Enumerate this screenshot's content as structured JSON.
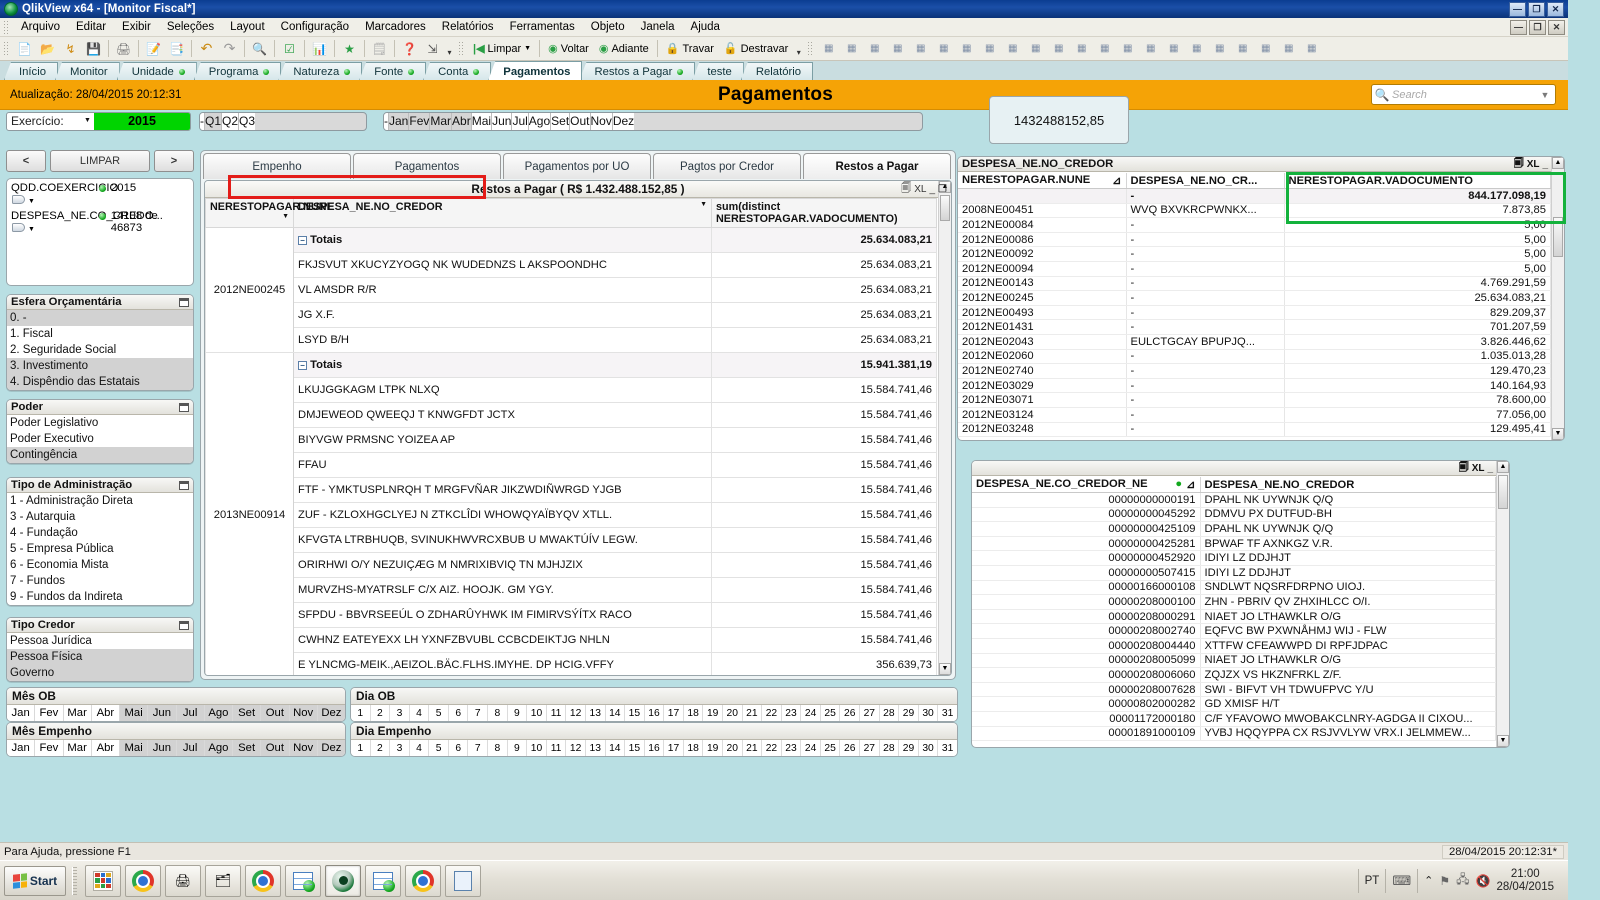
{
  "window": {
    "title": "QlikView x64 - [Monitor Fiscal*]",
    "app_icon": "qlikview-logo-icon",
    "controls": {
      "minimize": "—",
      "maximize": "❐",
      "close": "✕",
      "doc_minimize": "—",
      "doc_restore": "❐",
      "doc_close": "✕"
    }
  },
  "menu": [
    "Arquivo",
    "Editar",
    "Exibir",
    "Seleções",
    "Layout",
    "Configuração",
    "Marcadores",
    "Relatórios",
    "Ferramentas",
    "Objeto",
    "Janela",
    "Ajuda"
  ],
  "toolbar": {
    "group1_icons": [
      "new-document-icon",
      "open-folder-icon",
      "reload-icon",
      "save-icon"
    ],
    "print_icon": "print-icon",
    "group2_icons": [
      "edit-script-icon",
      "table-viewer-icon"
    ],
    "undo_icon": "undo-icon",
    "redo_icon": "redo-icon",
    "search_icon": "search-icon",
    "select-icon": "checkmark-icon",
    "chart_icon": "chart-icon",
    "favorite_icon": "star-icon",
    "notes_icon": "notes-icon",
    "help_icon": "help-icon",
    "context-help_icon": "context-help-icon",
    "clear_label": "Limpar",
    "back_label": "Voltar",
    "forward_label": "Adiante",
    "lock_label": "Travar",
    "unlock_label": "Destravar"
  },
  "sheet_tabs": [
    {
      "label": "Início",
      "active": false,
      "dot": false
    },
    {
      "label": "Monitor",
      "active": false,
      "dot": false
    },
    {
      "label": "Unidade",
      "active": false,
      "dot": true
    },
    {
      "label": "Programa",
      "active": false,
      "dot": true
    },
    {
      "label": "Natureza",
      "active": false,
      "dot": true
    },
    {
      "label": "Fonte",
      "active": false,
      "dot": true
    },
    {
      "label": "Conta",
      "active": false,
      "dot": true
    },
    {
      "label": "Pagamentos",
      "active": true,
      "dot": false
    },
    {
      "label": "Restos a Pagar",
      "active": false,
      "dot": true
    },
    {
      "label": "teste",
      "active": false,
      "dot": false
    },
    {
      "label": "Relatório",
      "active": false,
      "dot": false
    }
  ],
  "header": {
    "update_label": "Atualização: 28/04/2015 20:12:31",
    "title": "Pagamentos",
    "search_placeholder": "Search",
    "search_icon": "search-icon",
    "dropdown_icon": "chevron-down-icon"
  },
  "exercicio": {
    "label": "Exercício:",
    "value": "2015"
  },
  "quarters": [
    {
      "label": "-",
      "selected": false
    },
    {
      "label": "Q1",
      "selected": true
    },
    {
      "label": "Q2",
      "selected": false
    },
    {
      "label": "Q3",
      "selected": false
    }
  ],
  "months_top": [
    {
      "label": "-",
      "selected": false
    },
    {
      "label": "Jan",
      "selected": true
    },
    {
      "label": "Fev",
      "selected": true
    },
    {
      "label": "Mar",
      "selected": true
    },
    {
      "label": "Abr",
      "selected": true
    },
    {
      "label": "Mai",
      "selected": false
    },
    {
      "label": "Jun",
      "selected": false
    },
    {
      "label": "Jul",
      "selected": false
    },
    {
      "label": "Ago",
      "selected": false
    },
    {
      "label": "Set",
      "selected": false
    },
    {
      "label": "Out",
      "selected": false
    },
    {
      "label": "Nov",
      "selected": false
    },
    {
      "label": "Dez",
      "selected": false
    }
  ],
  "nav_buttons": {
    "prev": "<",
    "clear": "LIMPAR",
    "next": ">"
  },
  "current_selections": [
    {
      "field": "QDD.COEXERCICIO",
      "value": "2015"
    },
    {
      "field": "DESPESA_NE.CO_CREDO...",
      "value": "14108 de 46873"
    }
  ],
  "listboxes": [
    {
      "title": "Esfera Orçamentária",
      "items": [
        {
          "label": "0. -",
          "state": "gray"
        },
        {
          "label": "1. Fiscal",
          "state": "white"
        },
        {
          "label": "2. Seguridade Social",
          "state": "white"
        },
        {
          "label": "3. Investimento",
          "state": "gray"
        },
        {
          "label": "4. Dispêndio das Estatais",
          "state": "gray"
        }
      ]
    },
    {
      "title": "Poder",
      "items": [
        {
          "label": "Poder Legislativo",
          "state": "white"
        },
        {
          "label": "Poder Executivo",
          "state": "white"
        },
        {
          "label": "Contingência",
          "state": "gray"
        }
      ]
    },
    {
      "title": "Tipo de Administração",
      "items": [
        {
          "label": "1 - Administração Direta",
          "state": "white"
        },
        {
          "label": "3 - Autarquia",
          "state": "white"
        },
        {
          "label": "4 - Fundação",
          "state": "white"
        },
        {
          "label": "5 - Empresa Pública",
          "state": "white"
        },
        {
          "label": "6 - Economia Mista",
          "state": "white"
        },
        {
          "label": "7 - Fundos",
          "state": "white"
        },
        {
          "label": "9 - Fundos da Indireta",
          "state": "white"
        }
      ]
    },
    {
      "title": "Tipo Credor",
      "items": [
        {
          "label": "Pessoa Jurídica",
          "state": "white"
        },
        {
          "label": "Pessoa Física",
          "state": "gray"
        },
        {
          "label": "Governo",
          "state": "gray"
        }
      ]
    }
  ],
  "center": {
    "tabs": [
      {
        "label": "Empenho",
        "active": false
      },
      {
        "label": "Pagamentos",
        "active": false
      },
      {
        "label": "Pagamentos por UO",
        "active": false
      },
      {
        "label": "Pagtos por Credor",
        "active": false
      },
      {
        "label": "Restos a Pagar",
        "active": true
      }
    ],
    "chart_title": "Restos a Pagar ( R$ 1.432.488.152,85 )",
    "export_icon": "export-excel-icon",
    "export_label": "XL",
    "minimize_icon": "minimize-icon",
    "maximize_icon": "maximize-icon",
    "columns": [
      "NERESTOPAGAR.NUNE",
      "DESPESA_NE.NO_CREDOR",
      "sum(distinct NERESTOPAGAR.VADOCUMENTO)"
    ],
    "sort_icon": "sort-chevron-icon",
    "groups": [
      {
        "dim": "2012NE00245",
        "total_label": "Totais",
        "total_value": "25.634.083,21",
        "rows": [
          {
            "credor": "FKJSVUT  XKUCYZYOGQ NK  WUDEDNZS L  AKSPOONDHC",
            "value": "25.634.083,21"
          },
          {
            "credor": "VL AMSDR R/R",
            "value": "25.634.083,21"
          },
          {
            "credor": "JG X.F.",
            "value": "25.634.083,21"
          },
          {
            "credor": "LSYD B/H",
            "value": "25.634.083,21"
          }
        ]
      },
      {
        "dim": "2013NE00914",
        "total_label": "Totais",
        "total_value": "15.941.381,19",
        "rows": [
          {
            "credor": "LKUJGGKAGM LTPK NLXQ",
            "value": "15.584.741,46"
          },
          {
            "credor": "DMJEWEOD  QWEEQJ  T  KNWGFDT  JCTX",
            "value": "15.584.741,46"
          },
          {
            "credor": "BIYVGW PRMSNC YOIZEA AP",
            "value": "15.584.741,46"
          },
          {
            "credor": "FFAU",
            "value": "15.584.741,46"
          },
          {
            "credor": "FTF -  YMKTUSPLNRQH  T  MRGFVÑAR  JIKZWDIÑWRGD  YJGB",
            "value": "15.584.741,46"
          },
          {
            "credor": "ZUF -  KZLOXHGCLYEJ N  ZTKCLÎDI  WHOWQYAÏBYQV  XTLL.",
            "value": "15.584.741,46"
          },
          {
            "credor": "KFVGTA  LTRBHUQB,  SVINUKHWVRCXBUB  U  MWAKTÚÍV  LEGW.",
            "value": "15.584.741,46"
          },
          {
            "credor": "ORIRHWI  O/Y  NEZUIÇÆG  M  NMRIXIBVIQ  TN  MJHJZIX",
            "value": "15.584.741,46"
          },
          {
            "credor": "MURVZHS-MYATRSLF C/X AIZ. HOOJK. GM YGY.",
            "value": "15.584.741,46"
          },
          {
            "credor": "SFPDU -  BBVRSEEÚL  O  ZDHARÛYHWK  IM  FIMIRVSÝÍTX  RACO",
            "value": "15.584.741,46"
          },
          {
            "credor": "CWHNZ  EATEYEXX  LH  YXNFZBVUBL  CCBCDEIKTJG  NHLN",
            "value": "15.584.741,46"
          },
          {
            "credor": "E  YLNCMG-MEIK.,AEIZOL.BÄC.FLHS.IMYHE.  DP  HCIG.VFFY",
            "value": "356.639,73"
          }
        ]
      }
    ]
  },
  "kpi": {
    "value": "1432488152,85"
  },
  "right_top": {
    "caption": "DESPESA_NE.NO_CREDOR",
    "export_icon": "export-excel-icon",
    "export_label": "XL",
    "minimize_icon": "minimize-icon",
    "maximize_icon": "maximize-icon",
    "columns": [
      "NERESTOPAGAR.NUNE",
      "DESPESA_NE.NO_CR...",
      "NERESTOPAGAR.VADOCUMENTO"
    ],
    "sort_icon": "sort-asc-icon",
    "total_row": {
      "nune": "",
      "credor": "-",
      "value": "844.177.098,19"
    },
    "rows": [
      {
        "nune": "2008NE00451",
        "credor": "WVQ BXVKRCPWNKX...",
        "value": "7.873,85"
      },
      {
        "nune": "2012NE00084",
        "credor": "-",
        "value": "5,00"
      },
      {
        "nune": "2012NE00086",
        "credor": "-",
        "value": "5,00"
      },
      {
        "nune": "2012NE00092",
        "credor": "-",
        "value": "5,00"
      },
      {
        "nune": "2012NE00094",
        "credor": "-",
        "value": "5,00"
      },
      {
        "nune": "2012NE00143",
        "credor": "-",
        "value": "4.769.291,59"
      },
      {
        "nune": "2012NE00245",
        "credor": "-",
        "value": "25.634.083,21"
      },
      {
        "nune": "2012NE00493",
        "credor": "-",
        "value": "829.209,37"
      },
      {
        "nune": "2012NE01431",
        "credor": "-",
        "value": "701.207,59"
      },
      {
        "nune": "2012NE02043",
        "credor": "EULCTGCAY BPUPJQ...",
        "value": "3.826.446,62"
      },
      {
        "nune": "2012NE02060",
        "credor": "-",
        "value": "1.035.013,28"
      },
      {
        "nune": "2012NE02740",
        "credor": "-",
        "value": "129.470,23"
      },
      {
        "nune": "2012NE03029",
        "credor": "-",
        "value": "140.164,93"
      },
      {
        "nune": "2012NE03071",
        "credor": "-",
        "value": "78.600,00"
      },
      {
        "nune": "2012NE03124",
        "credor": "-",
        "value": "77.056,00"
      },
      {
        "nune": "2012NE03248",
        "credor": "-",
        "value": "129.495,41"
      }
    ]
  },
  "right_bottom": {
    "export_icon": "export-excel-icon",
    "export_label": "XL",
    "minimize_icon": "minimize-icon",
    "maximize_icon": "maximize-icon",
    "columns": [
      "DESPESA_NE.CO_CREDOR_NE",
      "DESPESA_NE.NO_CREDOR"
    ],
    "sort_icon": "sort-asc-icon",
    "green_dot": "green-state-dot-icon",
    "rows": [
      {
        "code": "00000000000191",
        "name": "DPAHL NK UYWNJK Q/Q"
      },
      {
        "code": "00000000045292",
        "name": "DDMVU PX DUTFUD-BH"
      },
      {
        "code": "00000000425109",
        "name": "DPAHL NK UYWNJK Q/Q"
      },
      {
        "code": "00000000425281",
        "name": "BPWAF TF AXNKGZ V.R."
      },
      {
        "code": "00000000452920",
        "name": "IDIYI LZ DDJHJT"
      },
      {
        "code": "00000000507415",
        "name": "IDIYI LZ DDJHJT"
      },
      {
        "code": "00000166000108",
        "name": "SNDLWT NQSRFDRPNO UIOJ."
      },
      {
        "code": "00000208000100",
        "name": "ZHN - PBRIV QV ZHXIHLCC O/I."
      },
      {
        "code": "00000208000291",
        "name": "NIAET JO LTHAWKLR O/G"
      },
      {
        "code": "00000208002740",
        "name": "EQFVC BW PXWNÅHMJ WIJ - FLW"
      },
      {
        "code": "00000208004440",
        "name": "XTTFW CFEAWWPD DI RPFJDPAC"
      },
      {
        "code": "00000208005099",
        "name": "NIAET JO LTHAWKLR O/G"
      },
      {
        "code": "00000208006060",
        "name": "ZQJZX VS HKZNFRKL  Z/F."
      },
      {
        "code": "00000208007628",
        "name": "SWI - BIFVT VH TDWUFPVC Y/U"
      },
      {
        "code": "00000802000282",
        "name": "GD XMISF H/T"
      },
      {
        "code": "00001172000180",
        "name": "C/F  YFAVOWO  MWOBAKCLNRY-AGDGA    II  CIXOU..."
      },
      {
        "code": "00001891000109",
        "name": "YVBJ  HQQYPPA  CX  RSJVVLYW  VRX.I  JELMMEW..."
      }
    ]
  },
  "bottom_panels": [
    {
      "title": "Mês OB",
      "items": [
        {
          "label": "Jan",
          "selected": false
        },
        {
          "label": "Fev",
          "selected": false
        },
        {
          "label": "Mar",
          "selected": false
        },
        {
          "label": "Abr",
          "selected": false
        },
        {
          "label": "Mai",
          "selected": true
        },
        {
          "label": "Jun",
          "selected": true
        },
        {
          "label": "Jul",
          "selected": true
        },
        {
          "label": "Ago",
          "selected": true
        },
        {
          "label": "Set",
          "selected": true
        },
        {
          "label": "Out",
          "selected": true
        },
        {
          "label": "Nov",
          "selected": true
        },
        {
          "label": "Dez",
          "selected": true
        }
      ]
    },
    {
      "title": "Mês Empenho",
      "items": [
        {
          "label": "Jan",
          "selected": false
        },
        {
          "label": "Fev",
          "selected": false
        },
        {
          "label": "Mar",
          "selected": false
        },
        {
          "label": "Abr",
          "selected": false
        },
        {
          "label": "Mai",
          "selected": true
        },
        {
          "label": "Jun",
          "selected": true
        },
        {
          "label": "Jul",
          "selected": true
        },
        {
          "label": "Ago",
          "selected": true
        },
        {
          "label": "Set",
          "selected": true
        },
        {
          "label": "Out",
          "selected": true
        },
        {
          "label": "Nov",
          "selected": true
        },
        {
          "label": "Dez",
          "selected": true
        }
      ]
    }
  ],
  "day_panels": [
    {
      "title": "Dia OB",
      "days": [
        "1",
        "2",
        "3",
        "4",
        "5",
        "6",
        "7",
        "8",
        "9",
        "10",
        "11",
        "12",
        "13",
        "14",
        "15",
        "16",
        "17",
        "18",
        "19",
        "20",
        "21",
        "22",
        "23",
        "24",
        "25",
        "26",
        "27",
        "28",
        "29",
        "30",
        "31"
      ]
    },
    {
      "title": "Dia Empenho",
      "days": [
        "1",
        "2",
        "3",
        "4",
        "5",
        "6",
        "7",
        "8",
        "9",
        "10",
        "11",
        "12",
        "13",
        "14",
        "15",
        "16",
        "17",
        "18",
        "19",
        "20",
        "21",
        "22",
        "23",
        "24",
        "25",
        "26",
        "27",
        "28",
        "29",
        "30",
        "31"
      ]
    }
  ],
  "statusbar": {
    "help_text": "Para Ajuda, pressione F1",
    "timestamp": "28/04/2015 20:12:31*"
  },
  "taskbar": {
    "start_label": "Start",
    "items": [
      {
        "icon": "apps-grid-icon",
        "active": false
      },
      {
        "icon": "chrome-windows-icon",
        "active": false
      },
      {
        "icon": "printer-icon",
        "active": false
      },
      {
        "icon": "folder-icon",
        "active": false
      },
      {
        "icon": "chrome-icon",
        "active": false
      },
      {
        "icon": "qlikview-doc-icon",
        "active": false
      },
      {
        "icon": "qlikview-icon",
        "active": true
      },
      {
        "icon": "qlikview-doc-icon",
        "active": false
      },
      {
        "icon": "chrome-icon",
        "active": false
      },
      {
        "icon": "calculator-icon",
        "active": false
      }
    ],
    "tray": {
      "language": "PT",
      "keyboard_icon": "keyboard-icon",
      "show_hidden_icon": "chevron-up-icon",
      "flag_icon": "flag-icon",
      "network_icon": "network-icon",
      "volume_muted_icon": "volume-muted-icon",
      "time": "21:00",
      "date": "28/04/2015"
    }
  },
  "annotations": {
    "red_highlight": "#e31c18",
    "green_highlight": "#13b23c"
  }
}
